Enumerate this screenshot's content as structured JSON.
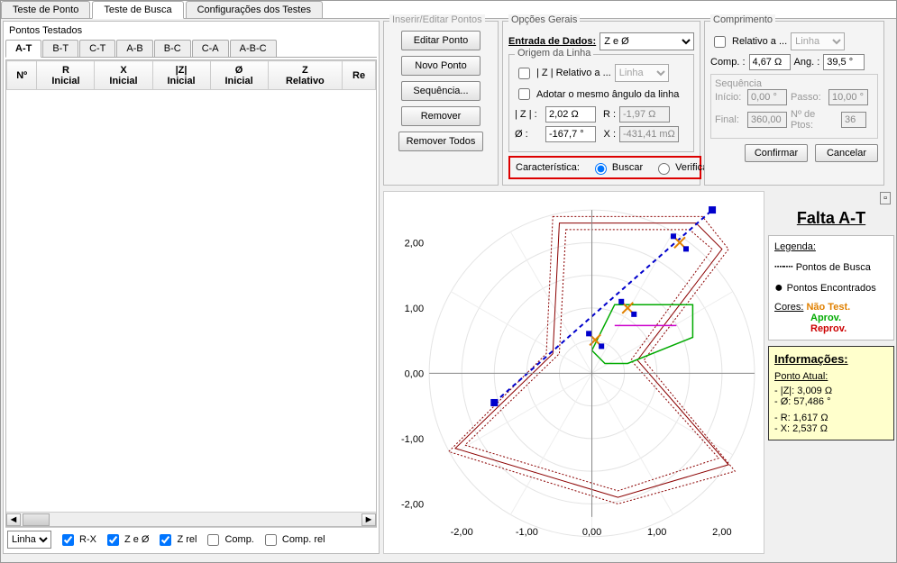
{
  "main_tabs": [
    "Teste de Ponto",
    "Teste de Busca",
    "Configurações dos Testes"
  ],
  "main_active": 1,
  "left": {
    "title": "Pontos Testados",
    "sub_tabs": [
      "A-T",
      "B-T",
      "C-T",
      "A-B",
      "B-C",
      "C-A",
      "A-B-C"
    ],
    "sub_active": 0,
    "cols": [
      "Nº",
      "R\nInicial",
      "X\nInicial",
      "|Z|\nInicial",
      "Ø\nInicial",
      "Z\nRelativo",
      "Re"
    ],
    "dropdown_value": "Linha",
    "checks": {
      "rx": "R-X",
      "zeo": "Z e Ø",
      "zrel": "Z rel",
      "comp": "Comp.",
      "comprel": "Comp. rel"
    }
  },
  "inserir": {
    "title": "Inserir/Editar Pontos",
    "editar": "Editar Ponto",
    "novo": "Novo Ponto",
    "sequencia": "Sequência...",
    "remover": "Remover",
    "remover_todos": "Remover Todos"
  },
  "opgerais": {
    "title": "Opções Gerais",
    "entrada": "Entrada de Dados:",
    "entrada_value": "Z e Ø",
    "origem_title": "Origem da Linha",
    "z_relativo": "| Z | Relativo a ...",
    "z_rel_value": "Linha",
    "adotar": "Adotar o mesmo ângulo da linha",
    "z_label": "| Z | :",
    "z_val": "2,02 Ω",
    "r_label": "R :",
    "r_val": "-1,97 Ω",
    "o_label": "Ø :",
    "o_val": "-167,7 °",
    "x_label": "X :",
    "x_val": "-431,41 mΩ",
    "caract": "Característica:",
    "buscar": "Buscar",
    "verificar": "Verificar"
  },
  "comprimento": {
    "title": "Comprimento",
    "relativo": "Relativo a ...",
    "relativo_value": "Linha",
    "comp_label": "Comp. :",
    "comp_val": "4,67 Ω",
    "ang_label": "Ang. :",
    "ang_val": "39,5 °",
    "seq_title": "Sequência",
    "inicio": "Início:",
    "inicio_val": "0,00 °",
    "passo": "Passo:",
    "passo_val": "10,00 °",
    "final": "Final:",
    "final_val": "360,00 °",
    "nptos": "Nº de Ptos:",
    "nptos_val": "36",
    "confirmar": "Confirmar",
    "cancelar": "Cancelar"
  },
  "falta": {
    "title": "Falta A-T",
    "legenda": "Legenda:",
    "pontos_busca": "Pontos de Busca",
    "pontos_enc": "Pontos Encontrados",
    "cores": "Cores:",
    "nao_test": "Não Test.",
    "aprov": "Aprov.",
    "reprov": "Reprov.",
    "info_title": "Informações:",
    "ponto_atual": "Ponto Atual:",
    "lz": "- |Z|: 3,009 Ω",
    "lo": "- Ø: 57,486 °",
    "lr": "- R: 1,617 Ω",
    "lx": "- X: 2,537 Ω"
  },
  "chart_data": {
    "type": "line",
    "xlim": [
      -2.5,
      2.5
    ],
    "ylim": [
      -2.2,
      2.5
    ],
    "xticks": [
      -2,
      -1,
      0,
      1,
      2
    ],
    "yticks": [
      -2,
      -1,
      0,
      1,
      2
    ],
    "search_line": [
      [
        -1.5,
        -0.45
      ],
      [
        1.85,
        2.5
      ]
    ],
    "points": [
      [
        0.05,
        0.51
      ],
      [
        0.55,
        1.0
      ],
      [
        1.35,
        2.0
      ]
    ]
  }
}
